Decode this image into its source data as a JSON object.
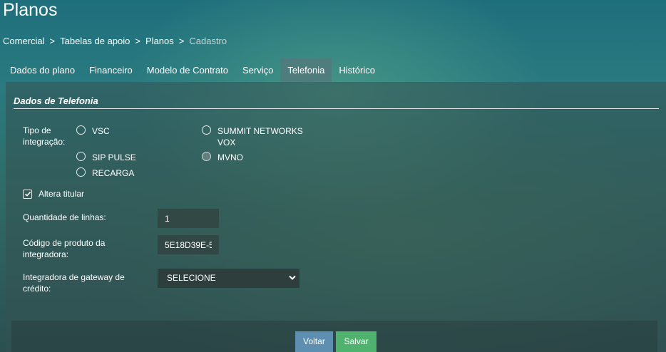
{
  "page": {
    "title": "Planos"
  },
  "breadcrumb": {
    "items": [
      "Comercial",
      "Tabelas de apoio",
      "Planos"
    ],
    "current": "Cadastro",
    "separator": ">"
  },
  "tabs": [
    {
      "label": "Dados do plano"
    },
    {
      "label": "Financeiro"
    },
    {
      "label": "Modelo de Contrato"
    },
    {
      "label": "Serviço"
    },
    {
      "label": "Telefonia",
      "active": true
    },
    {
      "label": "Histórico"
    }
  ],
  "section": {
    "title": "Dados de Telefonia"
  },
  "integration": {
    "label_line1": "Tipo de",
    "label_line2": "integração:",
    "options": [
      {
        "label": "VSC",
        "checked": false
      },
      {
        "label_line1": "SUMMIT NETWORKS",
        "label_line2": "VOX",
        "checked": false
      },
      {
        "label": "SIP PULSE",
        "checked": false
      },
      {
        "label": "MVNO",
        "checked": false
      },
      {
        "label": "RECARGA",
        "checked": false
      }
    ]
  },
  "altera_titular": {
    "label": "Altera titular",
    "checked": true
  },
  "quantidade_linhas": {
    "label": "Quantidade de linhas:",
    "value": "1"
  },
  "codigo_produto": {
    "label_line1": "Código de produto da",
    "label_line2": "integradora:",
    "value": "5E18D39E-5"
  },
  "gateway": {
    "label_line1": "Integradora de gateway de",
    "label_line2": "crédito:",
    "selected": "SELECIONE"
  },
  "buttons": {
    "back": "Voltar",
    "save": "Salvar"
  },
  "colors": {
    "back_button": "#5e8fb0",
    "save_button": "#4fb36f"
  }
}
